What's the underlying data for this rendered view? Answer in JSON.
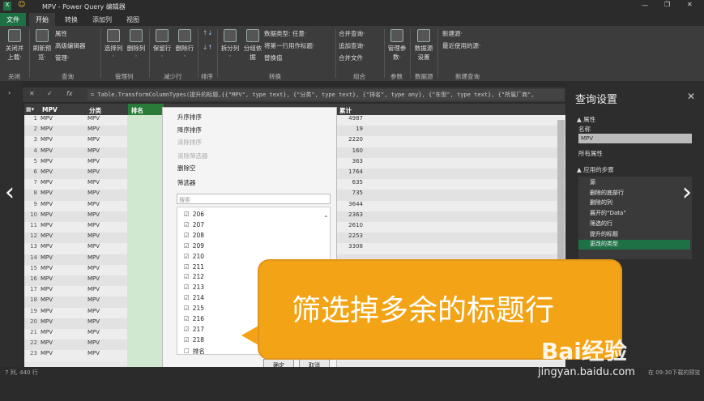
{
  "titlebar": {
    "title": "MPV - Power Query 编辑器"
  },
  "tabs": [
    "文件",
    "开始",
    "转换",
    "添加列",
    "视图"
  ],
  "ribbon": {
    "close_apply": "关闭并上载·",
    "refresh": "刷新预览·",
    "props": "属性",
    "adv_editor": "高级编辑器",
    "manage": "管理·",
    "choose_cols": "选择列·",
    "remove_cols": "删除列·",
    "keep_rows": "保留行·",
    "remove_rows": "删除行·",
    "split": "拆分列·",
    "groupby": "分组依据",
    "datatype": "数据类型: 任意·",
    "first_row_header": "将第一行用作标题·",
    "replace": "替换值",
    "merge_q": "合并查询·",
    "append_q": "追加查询·",
    "combine_files": "合并文件",
    "manage_params": "管理参数·",
    "ds_settings": "数据源设置",
    "new_source": "新建源·",
    "recent": "最近使用的源·",
    "groups": [
      "关闭",
      "查询",
      "管理列",
      "减少行",
      "排序",
      "转换",
      "组合",
      "参数",
      "数据源",
      "新建查询"
    ]
  },
  "formula": "= Table.TransformColumnTypes(提升的标题,{{\"MPV\", type text}, {\"分类\", type text}, {\"排名\", type any}, {\"车型\", type text}, {\"所属厂商\",",
  "grid": {
    "col1": "MPV",
    "col2": "分类",
    "col3": "排名",
    "col4": "累计",
    "rows": [
      {
        "n": "1",
        "a": "MPV",
        "b": "MPV",
        "v": "4987"
      },
      {
        "n": "2",
        "a": "MPV",
        "b": "MPV",
        "v": "19"
      },
      {
        "n": "3",
        "a": "MPV",
        "b": "MPV",
        "v": "2220"
      },
      {
        "n": "4",
        "a": "MPV",
        "b": "MPV",
        "v": "160"
      },
      {
        "n": "5",
        "a": "MPV",
        "b": "MPV",
        "v": "363"
      },
      {
        "n": "6",
        "a": "MPV",
        "b": "MPV",
        "v": "1764"
      },
      {
        "n": "7",
        "a": "MPV",
        "b": "MPV",
        "v": "635"
      },
      {
        "n": "8",
        "a": "MPV",
        "b": "MPV",
        "v": "735"
      },
      {
        "n": "9",
        "a": "MPV",
        "b": "MPV",
        "v": "3644"
      },
      {
        "n": "10",
        "a": "MPV",
        "b": "MPV",
        "v": "2363"
      },
      {
        "n": "11",
        "a": "MPV",
        "b": "MPV",
        "v": "2610"
      },
      {
        "n": "12",
        "a": "MPV",
        "b": "MPV",
        "v": "2253"
      },
      {
        "n": "13",
        "a": "MPV",
        "b": "MPV",
        "v": "3308"
      },
      {
        "n": "14",
        "a": "MPV",
        "b": "MPV",
        "v": ""
      },
      {
        "n": "15",
        "a": "MPV",
        "b": "MPV",
        "v": ""
      },
      {
        "n": "16",
        "a": "MPV",
        "b": "MPV",
        "v": ""
      },
      {
        "n": "17",
        "a": "MPV",
        "b": "MPV",
        "v": ""
      },
      {
        "n": "18",
        "a": "MPV",
        "b": "MPV",
        "v": ""
      },
      {
        "n": "19",
        "a": "MPV",
        "b": "MPV",
        "v": ""
      },
      {
        "n": "20",
        "a": "MPV",
        "b": "MPV",
        "v": ""
      },
      {
        "n": "21",
        "a": "MPV",
        "b": "MPV",
        "v": ""
      },
      {
        "n": "22",
        "a": "MPV",
        "b": "MPV",
        "v": ""
      },
      {
        "n": "23",
        "a": "MPV",
        "b": "MPV",
        "v": "7350"
      }
    ]
  },
  "menu": {
    "asc": "升序排序",
    "desc": "降序排序",
    "clear_sort": "清除排序",
    "clear_filter": "清除筛选器",
    "remove_empty": "删除空",
    "filters": "筛选器",
    "search": "搜索",
    "items": [
      "206",
      "207",
      "208",
      "209",
      "210",
      "211",
      "212",
      "213",
      "214",
      "215",
      "216",
      "217",
      "218",
      "排名"
    ],
    "ok": "确定",
    "cancel": "取消"
  },
  "qs": {
    "title": "查询设置",
    "props": "▲ 属性",
    "name_label": "名称",
    "name": "MPV",
    "all_props": "所有属性",
    "steps_label": "▲ 应用的步骤",
    "steps": [
      "源",
      "删除的底部行",
      "删除的列",
      "展开的“Data”",
      "筛选的行",
      "提升的标题",
      "更改的类型"
    ]
  },
  "status": "7 列, 440 行",
  "status_right": "在 09:30下载的预览",
  "overlay": "筛选掉多余的标题行",
  "watermark": {
    "brand": "Bai经验",
    "url": "jingyan.baidu.com"
  },
  "colors": {
    "accent": "#f3a416",
    "ribbon": "#3c3c3c",
    "selected_step": "#1e7145"
  }
}
